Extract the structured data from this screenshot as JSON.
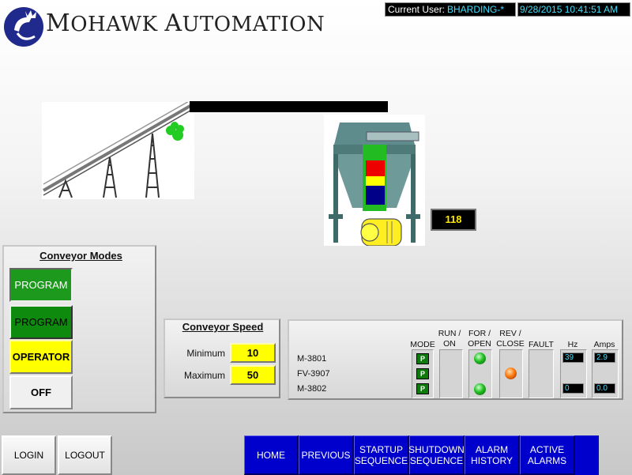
{
  "header": {
    "brand_first_initial": "M",
    "brand_first_rest": "OHAWK",
    "brand_second_initial": "A",
    "brand_second_rest": "UTOMATION",
    "user_label": "Current User:",
    "user_value": "BHARDING-*",
    "datetime": "9/28/2015 10:41:51 AM"
  },
  "hopper": {
    "level_value": "118"
  },
  "conveyor_modes": {
    "title": "Conveyor Modes",
    "buttons": [
      "PROGRAM",
      "PROGRAM",
      "OPERATOR",
      "OFF"
    ]
  },
  "conveyor_speed": {
    "title": "Conveyor Speed",
    "min_label": "Minimum",
    "min_value": "10",
    "max_label": "Maximum",
    "max_value": "50"
  },
  "status": {
    "columns": {
      "mode": "MODE",
      "run_on_1": "RUN /",
      "run_on_2": "ON",
      "for_open_1": "FOR /",
      "for_open_2": "OPEN",
      "rev_close_1": "REV /",
      "rev_close_2": "CLOSE",
      "fault": "FAULT",
      "hz": "Hz",
      "amps": "Amps"
    },
    "devices": [
      {
        "name": "M-3801",
        "mode": "P",
        "hz": "39",
        "amps": "2.9"
      },
      {
        "name": "FV-3907",
        "mode": "P"
      },
      {
        "name": "M-3802",
        "mode": "P",
        "hz": "0",
        "amps": "0.0"
      }
    ]
  },
  "nav": {
    "login": "LOGIN",
    "logout": "LOGOUT",
    "home": "HOME",
    "previous": "PREVIOUS",
    "startup_1": "STARTUP",
    "startup_2": "SEQUENCE",
    "shutdown_1": "SHUTDOWN",
    "shutdown_2": "SEQUENCE",
    "alarm_history_1": "ALARM",
    "alarm_history_2": "HISTORY",
    "active_alarms_1": "ACTIVE",
    "active_alarms_2": "ALARMS"
  },
  "icons": {
    "logo": "mohawk-crown-logo-icon",
    "lamp_on": "green-lamp-icon",
    "lamp_reverse": "orange-lamp-icon"
  },
  "colors": {
    "nav_blue": "#0000cc",
    "mode_green": "#1d9a1d",
    "operator_yellow": "#ffff00",
    "readout_cyan": "#3fe0ff",
    "readout_yellow": "#ffe800"
  }
}
